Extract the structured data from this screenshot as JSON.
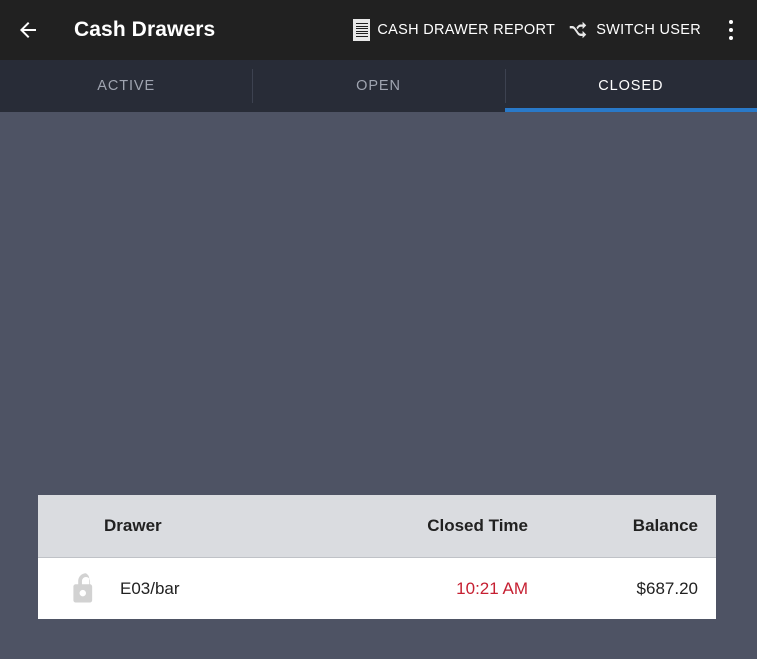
{
  "appbar": {
    "back_icon": "arrow-left-icon",
    "title": "Cash Drawers",
    "actions": [
      {
        "icon": "report-document-icon",
        "label": "CASH DRAWER REPORT"
      },
      {
        "icon": "shuffle-icon",
        "label": "SWITCH USER"
      }
    ],
    "overflow_icon": "more-vertical-icon"
  },
  "tabs": [
    {
      "label": "ACTIVE",
      "active": false
    },
    {
      "label": "OPEN",
      "active": false
    },
    {
      "label": "CLOSED",
      "active": true
    }
  ],
  "table": {
    "columns": {
      "drawer": "Drawer",
      "closed_time": "Closed Time",
      "balance": "Balance"
    },
    "rows": [
      {
        "status_icon": "unlock-icon",
        "drawer": "E03/bar",
        "closed_time": "10:21 AM",
        "balance": "$687.20"
      }
    ]
  },
  "colors": {
    "appbar_bg": "#212121",
    "tabbar_bg": "#282c37",
    "page_bg": "#4e5364",
    "tab_active_indicator": "#2979c8",
    "tab_active_text": "#ffffff",
    "tab_inactive_text": "#9fa4b0",
    "table_header_bg": "#dadce0",
    "table_row_bg": "#ffffff",
    "time_text": "#c62032",
    "primary_text": "#212121",
    "lock_icon": "#d2d2d2"
  }
}
